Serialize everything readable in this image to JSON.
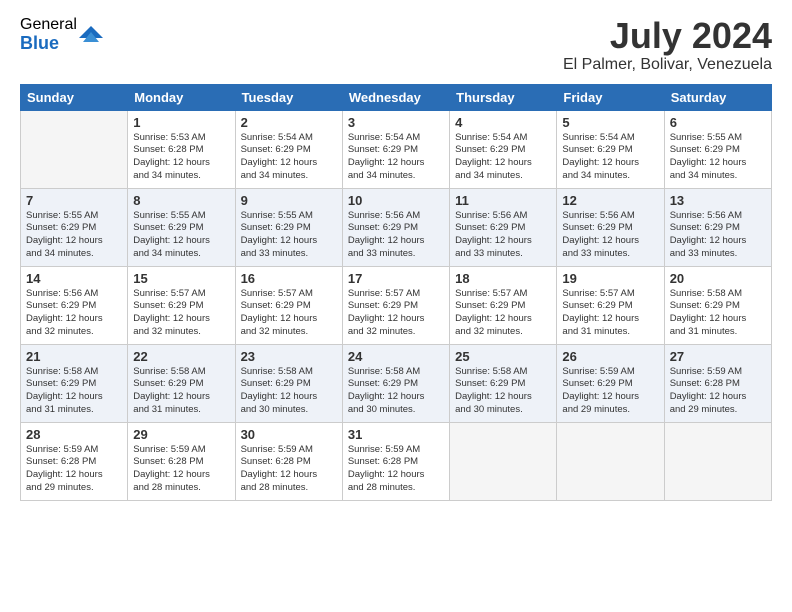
{
  "logo": {
    "general": "General",
    "blue": "Blue"
  },
  "title": {
    "month_year": "July 2024",
    "location": "El Palmer, Bolivar, Venezuela"
  },
  "days_of_week": [
    "Sunday",
    "Monday",
    "Tuesday",
    "Wednesday",
    "Thursday",
    "Friday",
    "Saturday"
  ],
  "weeks": [
    [
      {
        "day": "",
        "info": ""
      },
      {
        "day": "1",
        "info": "Sunrise: 5:53 AM\nSunset: 6:28 PM\nDaylight: 12 hours\nand 34 minutes."
      },
      {
        "day": "2",
        "info": "Sunrise: 5:54 AM\nSunset: 6:29 PM\nDaylight: 12 hours\nand 34 minutes."
      },
      {
        "day": "3",
        "info": "Sunrise: 5:54 AM\nSunset: 6:29 PM\nDaylight: 12 hours\nand 34 minutes."
      },
      {
        "day": "4",
        "info": "Sunrise: 5:54 AM\nSunset: 6:29 PM\nDaylight: 12 hours\nand 34 minutes."
      },
      {
        "day": "5",
        "info": "Sunrise: 5:54 AM\nSunset: 6:29 PM\nDaylight: 12 hours\nand 34 minutes."
      },
      {
        "day": "6",
        "info": "Sunrise: 5:55 AM\nSunset: 6:29 PM\nDaylight: 12 hours\nand 34 minutes."
      }
    ],
    [
      {
        "day": "7",
        "info": "Sunrise: 5:55 AM\nSunset: 6:29 PM\nDaylight: 12 hours\nand 34 minutes."
      },
      {
        "day": "8",
        "info": "Sunrise: 5:55 AM\nSunset: 6:29 PM\nDaylight: 12 hours\nand 34 minutes."
      },
      {
        "day": "9",
        "info": "Sunrise: 5:55 AM\nSunset: 6:29 PM\nDaylight: 12 hours\nand 33 minutes."
      },
      {
        "day": "10",
        "info": "Sunrise: 5:56 AM\nSunset: 6:29 PM\nDaylight: 12 hours\nand 33 minutes."
      },
      {
        "day": "11",
        "info": "Sunrise: 5:56 AM\nSunset: 6:29 PM\nDaylight: 12 hours\nand 33 minutes."
      },
      {
        "day": "12",
        "info": "Sunrise: 5:56 AM\nSunset: 6:29 PM\nDaylight: 12 hours\nand 33 minutes."
      },
      {
        "day": "13",
        "info": "Sunrise: 5:56 AM\nSunset: 6:29 PM\nDaylight: 12 hours\nand 33 minutes."
      }
    ],
    [
      {
        "day": "14",
        "info": "Sunrise: 5:56 AM\nSunset: 6:29 PM\nDaylight: 12 hours\nand 32 minutes."
      },
      {
        "day": "15",
        "info": "Sunrise: 5:57 AM\nSunset: 6:29 PM\nDaylight: 12 hours\nand 32 minutes."
      },
      {
        "day": "16",
        "info": "Sunrise: 5:57 AM\nSunset: 6:29 PM\nDaylight: 12 hours\nand 32 minutes."
      },
      {
        "day": "17",
        "info": "Sunrise: 5:57 AM\nSunset: 6:29 PM\nDaylight: 12 hours\nand 32 minutes."
      },
      {
        "day": "18",
        "info": "Sunrise: 5:57 AM\nSunset: 6:29 PM\nDaylight: 12 hours\nand 32 minutes."
      },
      {
        "day": "19",
        "info": "Sunrise: 5:57 AM\nSunset: 6:29 PM\nDaylight: 12 hours\nand 31 minutes."
      },
      {
        "day": "20",
        "info": "Sunrise: 5:58 AM\nSunset: 6:29 PM\nDaylight: 12 hours\nand 31 minutes."
      }
    ],
    [
      {
        "day": "21",
        "info": "Sunrise: 5:58 AM\nSunset: 6:29 PM\nDaylight: 12 hours\nand 31 minutes."
      },
      {
        "day": "22",
        "info": "Sunrise: 5:58 AM\nSunset: 6:29 PM\nDaylight: 12 hours\nand 31 minutes."
      },
      {
        "day": "23",
        "info": "Sunrise: 5:58 AM\nSunset: 6:29 PM\nDaylight: 12 hours\nand 30 minutes."
      },
      {
        "day": "24",
        "info": "Sunrise: 5:58 AM\nSunset: 6:29 PM\nDaylight: 12 hours\nand 30 minutes."
      },
      {
        "day": "25",
        "info": "Sunrise: 5:58 AM\nSunset: 6:29 PM\nDaylight: 12 hours\nand 30 minutes."
      },
      {
        "day": "26",
        "info": "Sunrise: 5:59 AM\nSunset: 6:29 PM\nDaylight: 12 hours\nand 29 minutes."
      },
      {
        "day": "27",
        "info": "Sunrise: 5:59 AM\nSunset: 6:28 PM\nDaylight: 12 hours\nand 29 minutes."
      }
    ],
    [
      {
        "day": "28",
        "info": "Sunrise: 5:59 AM\nSunset: 6:28 PM\nDaylight: 12 hours\nand 29 minutes."
      },
      {
        "day": "29",
        "info": "Sunrise: 5:59 AM\nSunset: 6:28 PM\nDaylight: 12 hours\nand 28 minutes."
      },
      {
        "day": "30",
        "info": "Sunrise: 5:59 AM\nSunset: 6:28 PM\nDaylight: 12 hours\nand 28 minutes."
      },
      {
        "day": "31",
        "info": "Sunrise: 5:59 AM\nSunset: 6:28 PM\nDaylight: 12 hours\nand 28 minutes."
      },
      {
        "day": "",
        "info": ""
      },
      {
        "day": "",
        "info": ""
      },
      {
        "day": "",
        "info": ""
      }
    ]
  ]
}
